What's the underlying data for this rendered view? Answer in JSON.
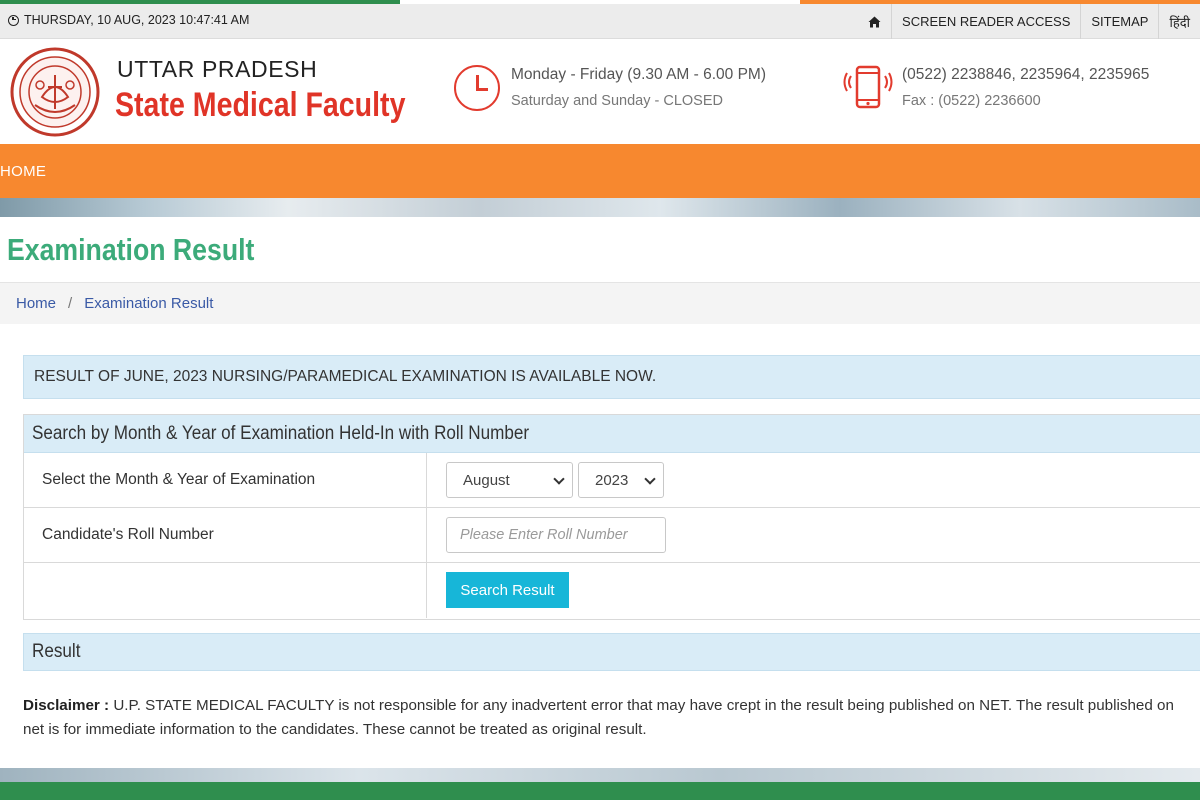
{
  "colors": {
    "tricolor_orange": "#f7882f",
    "tricolor_white": "#ffffff",
    "tricolor_green": "#2f8e4e",
    "nav_bg": "#f7882f",
    "title_green": "#3cab7a",
    "brand_red": "#e03427",
    "panel_blue": "#d9ecf7",
    "button_cyan": "#17b6d8"
  },
  "topbar": {
    "datetime": "THURSDAY, 10 AUG, 2023 10:47:41 AM",
    "links": [
      "SCREEN READER ACCESS",
      "SITEMAP",
      "हिंदी"
    ]
  },
  "header": {
    "org_top": "UTTAR PRADESH",
    "org_main": "State Medical Faculty",
    "hours_line1": "Monday - Friday (9.30 AM - 6.00 PM)",
    "hours_line2": "Saturday and Sunday - CLOSED",
    "phone_line1": "(0522) 2238846, 2235964, 2235965",
    "phone_line2": "Fax : (0522) 2236600"
  },
  "nav": {
    "items": [
      "HOME"
    ]
  },
  "page": {
    "title": "Examination Result",
    "breadcrumb": [
      "Home",
      "Examination Result"
    ],
    "notice": "RESULT OF JUNE, 2023 NURSING/PARAMEDICAL EXAMINATION IS AVAILABLE NOW."
  },
  "search": {
    "heading": "Search by Month & Year of Examination Held-In with Roll Number",
    "month_year_label": "Select the Month & Year of Examination",
    "month_value": "August",
    "year_value": "2023",
    "roll_label": "Candidate's Roll Number",
    "roll_placeholder": "Please Enter Roll Number",
    "button_label": "Search Result"
  },
  "result": {
    "heading": "Result"
  },
  "disclaimer": {
    "label": "Disclaimer :",
    "text": "U.P. STATE MEDICAL FACULTY is not responsible for any inadvertent error that may have crept in the result being published on NET. The result published on net is for immediate information to the candidates. These cannot be treated as original result."
  }
}
